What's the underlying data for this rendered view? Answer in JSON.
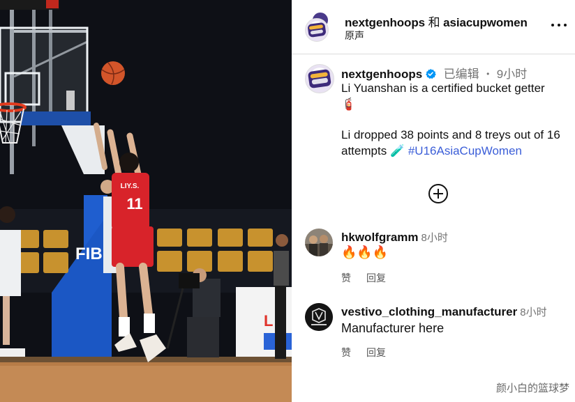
{
  "header": {
    "owner_name": "nextgenhoops",
    "joiner": "和",
    "collaborator_name": "asiacupwomen",
    "audio_label": "原声"
  },
  "post": {
    "username": "nextgenhoops",
    "edited_label": "已编辑",
    "separator": "•",
    "time": "9小时",
    "caption_line1": "Li Yuanshan is a certified bucket getter",
    "caption_emoji1": "🧯",
    "caption_line2": "Li dropped 38 points and 8 treys out of 16 attempts",
    "caption_emoji2": "🧪",
    "hashtag": "#U16AsiaCupWomen"
  },
  "comments": [
    {
      "username": "hkwolfgramm",
      "time": "8小时",
      "text": "🔥🔥🔥",
      "like_label": "赞",
      "reply_label": "回复"
    },
    {
      "username": "vestivo_clothing_manufacturer",
      "time": "8小时",
      "text": "Manufacturer here",
      "like_label": "赞",
      "reply_label": "回复"
    }
  ],
  "video": {
    "jersey_text": "LIY.S.",
    "jersey_number": "11",
    "banner_text": "FIB",
    "ad_text": "L"
  },
  "watermark": "颜小白的篮球梦",
  "colors": {
    "verified": "#0095f6",
    "hashtag": "#3b5ed8",
    "jersey_red": "#d8232a"
  },
  "icons": {
    "more": "more-horizontal-icon",
    "verified": "verified-badge-icon",
    "add_comment": "plus-circle-icon"
  }
}
